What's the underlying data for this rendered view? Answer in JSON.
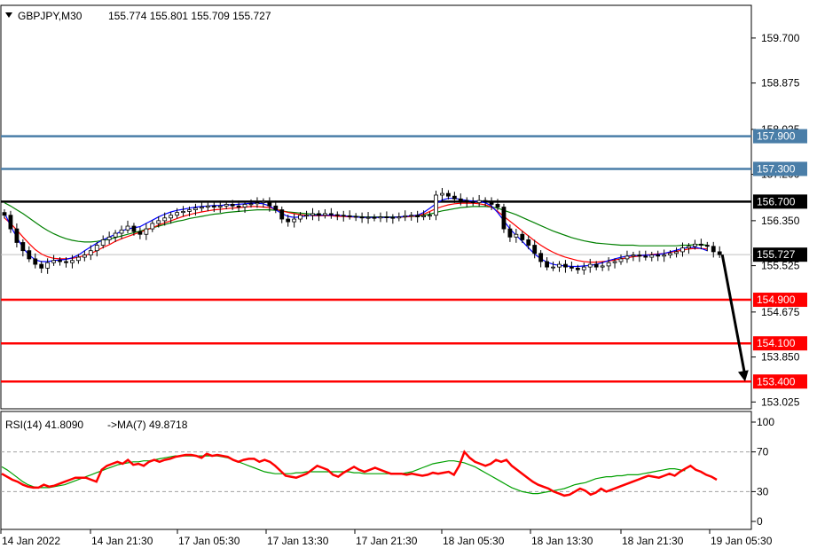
{
  "header": {
    "symbol": "GBPJPY,M30",
    "ohlc": "155.774 155.801 155.709 155.727"
  },
  "rsi_header": {
    "label": "RSI(14) 41.8090",
    "ma_label": "->MA(7) 49.8718"
  },
  "chart_data": [
    {
      "type": "candlestick",
      "symbol": "GBPJPY",
      "timeframe": "M30",
      "ylim": [
        152.9,
        160.3
      ],
      "y_ticks": [
        "159.700",
        "158.875",
        "158.025",
        "157.200",
        "156.350",
        "155.525",
        "154.675",
        "153.850",
        "153.025"
      ],
      "x_ticks": [
        "14 Jan 2022",
        "14 Jan 21:30",
        "17 Jan 05:30",
        "17 Jan 13:30",
        "17 Jan 21:30",
        "18 Jan 05:30",
        "18 Jan 13:30",
        "18 Jan 21:30",
        "19 Jan 05:30"
      ],
      "current_price": 155.727,
      "horizontal_levels": [
        {
          "value": 157.9,
          "label": "157.900",
          "color": "#4a7ea8"
        },
        {
          "value": 157.3,
          "label": "157.300",
          "color": "#4a7ea8"
        },
        {
          "value": 156.7,
          "label": "156.700",
          "color": "#000000"
        },
        {
          "value": 154.9,
          "label": "154.900",
          "color": "#ff0000"
        },
        {
          "value": 154.1,
          "label": "154.100",
          "color": "#ff0000"
        },
        {
          "value": 153.4,
          "label": "153.400",
          "color": "#ff0000"
        }
      ],
      "forecast_arrow": {
        "from": 155.727,
        "to": 153.4,
        "color": "#000000"
      },
      "closes": [
        156.45,
        156.2,
        155.95,
        155.8,
        155.65,
        155.55,
        155.48,
        155.58,
        155.62,
        155.6,
        155.58,
        155.62,
        155.68,
        155.72,
        155.8,
        155.9,
        156.0,
        156.05,
        156.12,
        156.18,
        156.25,
        156.15,
        156.1,
        156.2,
        156.3,
        156.35,
        156.4,
        156.45,
        156.5,
        156.52,
        156.55,
        156.58,
        156.6,
        156.62,
        156.6,
        156.62,
        156.65,
        156.62,
        156.6,
        156.65,
        156.66,
        156.68,
        156.7,
        156.62,
        156.55,
        156.38,
        156.33,
        156.38,
        156.45,
        156.45,
        156.48,
        156.45,
        156.48,
        156.46,
        156.45,
        156.44,
        156.43,
        156.42,
        156.4,
        156.41,
        156.4,
        156.42,
        156.41,
        156.4,
        156.42,
        156.44,
        156.45,
        156.42,
        156.44,
        156.45,
        156.82,
        156.85,
        156.8,
        156.75,
        156.72,
        156.7,
        156.68,
        156.72,
        156.7,
        156.65,
        156.6,
        156.2,
        156.05,
        156.1,
        156.0,
        155.9,
        155.75,
        155.6,
        155.5,
        155.5,
        155.55,
        155.5,
        155.48,
        155.45,
        155.5,
        155.55,
        155.5,
        155.52,
        155.58,
        155.6,
        155.65,
        155.7,
        155.72,
        155.7,
        155.68,
        155.72,
        155.7,
        155.72,
        155.75,
        155.78,
        155.85,
        155.88,
        155.92,
        155.9,
        155.88,
        155.78,
        155.727
      ],
      "ma_fast": [
        156.5,
        156.25,
        156.05,
        155.85,
        155.72,
        155.63,
        155.6,
        155.6,
        155.62,
        155.63,
        155.64,
        155.67,
        155.72,
        155.8,
        155.87,
        155.94,
        156.0,
        156.05,
        156.1,
        156.16,
        156.2,
        156.22,
        156.24,
        156.3,
        156.36,
        156.42,
        156.47,
        156.51,
        156.54,
        156.56,
        156.58,
        156.6,
        156.61,
        156.62,
        156.63,
        156.63,
        156.64,
        156.64,
        156.65,
        156.66,
        156.67,
        156.67,
        156.66,
        156.62,
        156.55,
        156.48,
        156.43,
        156.41,
        156.42,
        156.44,
        156.45,
        156.45,
        156.45,
        156.45,
        156.45,
        156.44,
        156.43,
        156.42,
        156.41,
        156.41,
        156.41,
        156.41,
        156.41,
        156.41,
        156.42,
        156.43,
        156.44,
        156.45,
        156.5,
        156.58,
        156.66,
        156.73,
        156.76,
        156.76,
        156.74,
        156.72,
        156.71,
        156.7,
        156.68,
        156.62,
        156.5,
        156.35,
        156.2,
        156.08,
        155.97,
        155.85,
        155.74,
        155.65,
        155.59,
        155.55,
        155.53,
        155.52,
        155.51,
        155.51,
        155.52,
        155.53,
        155.55,
        155.58,
        155.62,
        155.65,
        155.68,
        155.7,
        155.71,
        155.71,
        155.72,
        155.72,
        155.73,
        155.75,
        155.78,
        155.81,
        155.84,
        155.86,
        155.86,
        155.84,
        155.8
      ],
      "ma_mid": [
        156.4,
        156.3,
        156.18,
        156.05,
        155.93,
        155.82,
        155.74,
        155.69,
        155.66,
        155.65,
        155.65,
        155.66,
        155.68,
        155.71,
        155.75,
        155.8,
        155.86,
        155.91,
        155.97,
        156.02,
        156.06,
        156.1,
        156.14,
        156.18,
        156.22,
        156.27,
        156.31,
        156.35,
        156.39,
        156.43,
        156.46,
        156.49,
        156.51,
        156.53,
        156.55,
        156.56,
        156.57,
        156.58,
        156.59,
        156.6,
        156.61,
        156.61,
        156.6,
        156.59,
        156.56,
        156.53,
        156.5,
        156.48,
        156.46,
        156.45,
        156.44,
        156.44,
        156.44,
        156.44,
        156.43,
        156.43,
        156.42,
        156.42,
        156.41,
        156.41,
        156.41,
        156.41,
        156.41,
        156.41,
        156.42,
        156.42,
        156.43,
        156.44,
        156.47,
        156.52,
        156.57,
        156.61,
        156.64,
        156.66,
        156.67,
        156.67,
        156.67,
        156.66,
        156.64,
        156.6,
        156.52,
        156.43,
        156.34,
        156.25,
        156.16,
        156.07,
        155.98,
        155.9,
        155.83,
        155.77,
        155.72,
        155.68,
        155.65,
        155.62,
        155.6,
        155.59,
        155.59,
        155.6,
        155.61,
        155.63,
        155.65,
        155.67,
        155.69,
        155.7,
        155.72,
        155.73,
        155.74,
        155.75,
        155.77,
        155.79,
        155.81,
        155.83,
        155.84,
        155.84,
        155.83
      ],
      "ma_slow": [
        156.68,
        156.62,
        156.55,
        156.48,
        156.4,
        156.32,
        156.24,
        156.17,
        156.11,
        156.06,
        156.02,
        155.99,
        155.97,
        155.96,
        155.96,
        155.97,
        155.99,
        156.01,
        156.04,
        156.07,
        156.1,
        156.13,
        156.16,
        156.19,
        156.22,
        156.25,
        156.28,
        156.31,
        156.34,
        156.36,
        156.39,
        156.41,
        156.43,
        156.45,
        156.47,
        156.48,
        156.5,
        156.51,
        156.52,
        156.53,
        156.54,
        156.55,
        156.55,
        156.55,
        156.54,
        156.53,
        156.51,
        156.5,
        156.49,
        156.48,
        156.47,
        156.46,
        156.45,
        156.45,
        156.44,
        156.44,
        156.43,
        156.43,
        156.42,
        156.42,
        156.42,
        156.42,
        156.42,
        156.42,
        156.42,
        156.42,
        156.43,
        156.43,
        156.45,
        156.47,
        156.5,
        156.53,
        156.55,
        156.57,
        156.59,
        156.6,
        156.61,
        156.61,
        156.61,
        156.6,
        156.58,
        156.54,
        156.5,
        156.46,
        156.41,
        156.36,
        156.31,
        156.26,
        156.21,
        156.16,
        156.12,
        156.08,
        156.04,
        156.01,
        155.98,
        155.96,
        155.94,
        155.93,
        155.92,
        155.91,
        155.9,
        155.9,
        155.9,
        155.89,
        155.89,
        155.89,
        155.89,
        155.89,
        155.89,
        155.89,
        155.9,
        155.9,
        155.91,
        155.91,
        155.9
      ]
    },
    {
      "type": "line",
      "indicator": "RSI(14)",
      "ylim": [
        0,
        100
      ],
      "y_ticks": [
        "100",
        "70",
        "30",
        "0"
      ],
      "levels": [
        70,
        30
      ],
      "series": [
        {
          "name": "RSI(14)",
          "color": "#ff0000",
          "values": [
            48,
            45,
            42,
            40,
            37,
            35,
            34,
            34,
            37,
            35,
            36,
            38,
            40,
            42,
            44,
            44,
            44,
            42,
            40,
            52,
            56,
            58,
            60,
            58,
            62,
            57,
            58,
            56,
            60,
            62,
            60,
            62,
            63,
            65,
            66,
            67,
            67,
            66,
            64,
            68,
            66,
            67,
            66,
            65,
            62,
            60,
            62,
            63,
            63,
            60,
            62,
            60,
            56,
            51,
            46,
            45,
            44,
            46,
            48,
            52,
            56,
            54,
            52,
            47,
            45,
            49,
            52,
            55,
            52,
            50,
            52,
            54,
            52,
            50,
            48,
            48,
            48,
            47,
            48,
            47,
            46,
            47,
            49,
            48,
            49,
            50,
            47,
            56,
            70,
            64,
            60,
            58,
            56,
            58,
            62,
            60,
            62,
            56,
            52,
            48,
            44,
            40,
            37,
            35,
            33,
            30,
            28,
            26,
            27,
            30,
            33,
            31,
            27,
            29,
            33,
            30,
            32,
            34,
            36,
            38,
            40,
            42,
            44,
            46,
            45,
            44,
            46,
            48,
            46,
            50,
            53,
            56,
            52,
            50,
            47,
            45,
            42
          ]
        },
        {
          "name": "MA(7)",
          "color": "#00a000",
          "values": [
            55,
            52,
            48,
            44,
            40,
            37,
            35,
            34,
            34,
            34,
            35,
            36,
            37,
            39,
            41,
            43,
            45,
            47,
            49,
            51,
            53,
            55,
            57,
            58,
            59,
            60,
            60,
            61,
            61,
            62,
            63,
            64,
            65,
            66,
            66,
            66,
            66,
            66,
            66,
            66,
            66,
            66,
            65,
            64,
            62,
            60,
            58,
            56,
            54,
            52,
            50,
            49,
            48,
            48,
            48,
            48,
            49,
            49,
            50,
            50,
            50,
            50,
            50,
            50,
            50,
            50,
            50,
            49,
            49,
            48,
            48,
            48,
            48,
            48,
            48,
            48,
            48,
            49,
            50,
            52,
            54,
            56,
            58,
            59,
            60,
            61,
            61,
            60,
            59,
            57,
            55,
            52,
            49,
            46,
            43,
            40,
            37,
            34,
            32,
            30,
            29,
            28,
            28,
            29,
            30,
            31,
            32,
            33,
            35,
            37,
            38,
            39,
            41,
            43,
            44,
            45,
            45,
            46,
            46,
            47,
            47,
            47,
            48,
            49,
            50,
            51,
            52,
            53,
            53,
            52,
            51
          ]
        }
      ]
    }
  ],
  "colors": {
    "bull_candle": "#ffffff",
    "bear_candle": "#000000",
    "grid": "#c0c0c0",
    "label_blue": "#4a7ea8",
    "label_red": "#ff0000",
    "label_black": "#000000"
  }
}
